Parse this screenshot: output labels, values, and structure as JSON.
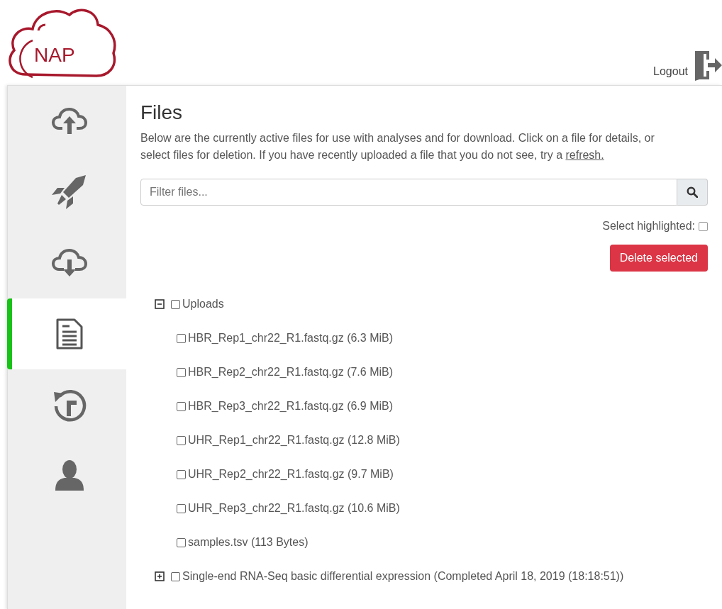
{
  "header": {
    "logo_text": "NAP",
    "logout": "Logout"
  },
  "sidebar": {
    "items": [
      {
        "kind": "upload",
        "selected": false
      },
      {
        "kind": "rocket",
        "selected": false
      },
      {
        "kind": "download",
        "selected": false
      },
      {
        "kind": "document",
        "selected": true
      },
      {
        "kind": "history",
        "selected": false
      },
      {
        "kind": "user",
        "selected": false
      }
    ]
  },
  "files": {
    "title": "Files",
    "intro": "Below are the currently active files for use with analyses and for download. Click on a file for details, or select files for deletion. If you have recently uploaded a file that you do not see, try a ",
    "intro_link": "refresh.",
    "filter": {
      "placeholder": "Filter files..."
    },
    "select_highlighted": {
      "label": "Select highlighted:",
      "checked": false
    },
    "delete_button": "Delete selected",
    "tree": [
      {
        "label": "Uploads",
        "checked": false,
        "expanded": true,
        "children": [
          {
            "label": "HBR_Rep1_chr22_R1.fastq.gz (6.3 MiB)",
            "checked": false
          },
          {
            "label": "HBR_Rep2_chr22_R1.fastq.gz (7.6 MiB)",
            "checked": false
          },
          {
            "label": "HBR_Rep3_chr22_R1.fastq.gz (6.9 MiB)",
            "checked": false
          },
          {
            "label": "UHR_Rep1_chr22_R1.fastq.gz (12.8 MiB)",
            "checked": false
          },
          {
            "label": "UHR_Rep2_chr22_R1.fastq.gz (9.7 MiB)",
            "checked": false
          },
          {
            "label": "UHR_Rep3_chr22_R1.fastq.gz (10.6 MiB)",
            "checked": false
          },
          {
            "label": "samples.tsv (113 Bytes)",
            "checked": false
          }
        ]
      },
      {
        "label": "Single-end RNA-Seq basic differential expression (Completed April 18, 2019 (18:18:51))",
        "checked": false,
        "expanded": false
      }
    ]
  }
}
